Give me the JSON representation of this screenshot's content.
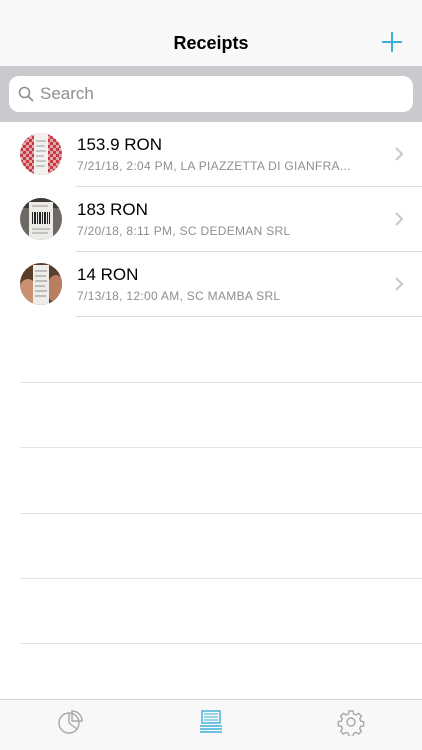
{
  "navbar": {
    "title": "Receipts",
    "add_icon": "plus-icon"
  },
  "search": {
    "placeholder": "Search",
    "value": ""
  },
  "receipts": [
    {
      "amount": "153.9 RON",
      "details": "7/21/18, 2:04 PM, LA PIAZZETTA DI GIANFRA...",
      "thumbnail": "receipt-photo-red-checked"
    },
    {
      "amount": "183 RON",
      "details": "7/20/18, 8:11 PM, SC DEDEMAN SRL",
      "thumbnail": "receipt-photo-barcode"
    },
    {
      "amount": "14 RON",
      "details": "7/13/18, 12:00 AM, SC MAMBA SRL",
      "thumbnail": "receipt-photo-hand"
    }
  ],
  "tabbar": {
    "tabs": [
      {
        "icon": "pie-chart-icon",
        "selected": false
      },
      {
        "icon": "receipts-stack-icon",
        "selected": true
      },
      {
        "icon": "gear-icon",
        "selected": false
      }
    ]
  },
  "colors": {
    "accent": "#3ab0d8",
    "navbar_bg": "#f8f8f8",
    "search_bar_bg": "#c9c9ce",
    "secondary_text": "#8e8e93",
    "inactive_tab": "#a8a8ad"
  }
}
